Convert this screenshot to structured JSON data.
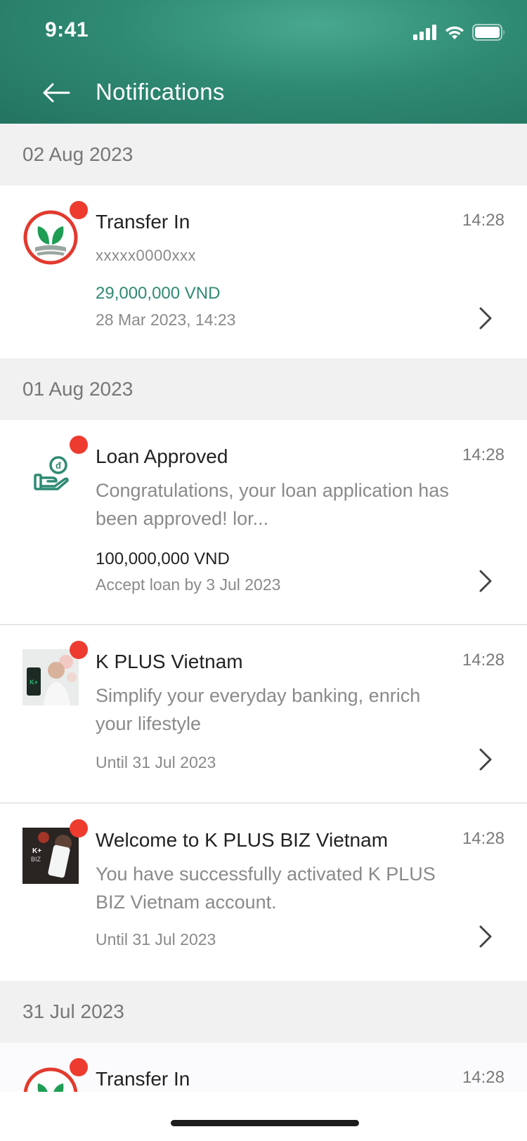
{
  "status_bar": {
    "time": "9:41"
  },
  "header": {
    "title": "Notifications"
  },
  "colors": {
    "accent": "#2f8a73",
    "amount_green": "#2f8a73",
    "unread_dot": "#ee3b2f"
  },
  "groups": [
    {
      "date": "02 Aug 2023",
      "items": [
        {
          "icon": "kbank-logo-icon",
          "title": "Transfer In",
          "time": "14:28",
          "account": "xxxxx0000xxx",
          "amount": "29,000,000 VND",
          "meta": "28 Mar 2023, 14:23"
        }
      ]
    },
    {
      "date": "01 Aug 2023",
      "items": [
        {
          "icon": "loan-hand-coin-icon",
          "title": "Loan Approved",
          "time": "14:28",
          "body": "Congratulations, your loan application has been approved! lor...",
          "amount": "100,000,000 VND",
          "meta": "Accept loan by 3 Jul 2023"
        },
        {
          "icon": "promo-kplus-image",
          "title": "K PLUS Vietnam",
          "time": "14:28",
          "body": "Simplify your everyday banking, enrich your lifestyle",
          "meta": "Until 31 Jul 2023"
        },
        {
          "icon": "promo-kplus-biz-image",
          "title": "Welcome to K PLUS BIZ Vietnam",
          "time": "14:28",
          "body": "You have successfully activated K PLUS BIZ Vietnam account.",
          "meta": "Until 31 Jul 2023"
        }
      ]
    },
    {
      "date": "31 Jul 2023",
      "items": [
        {
          "icon": "kbank-logo-icon",
          "title": "Transfer In",
          "time": "14:28"
        }
      ]
    }
  ]
}
